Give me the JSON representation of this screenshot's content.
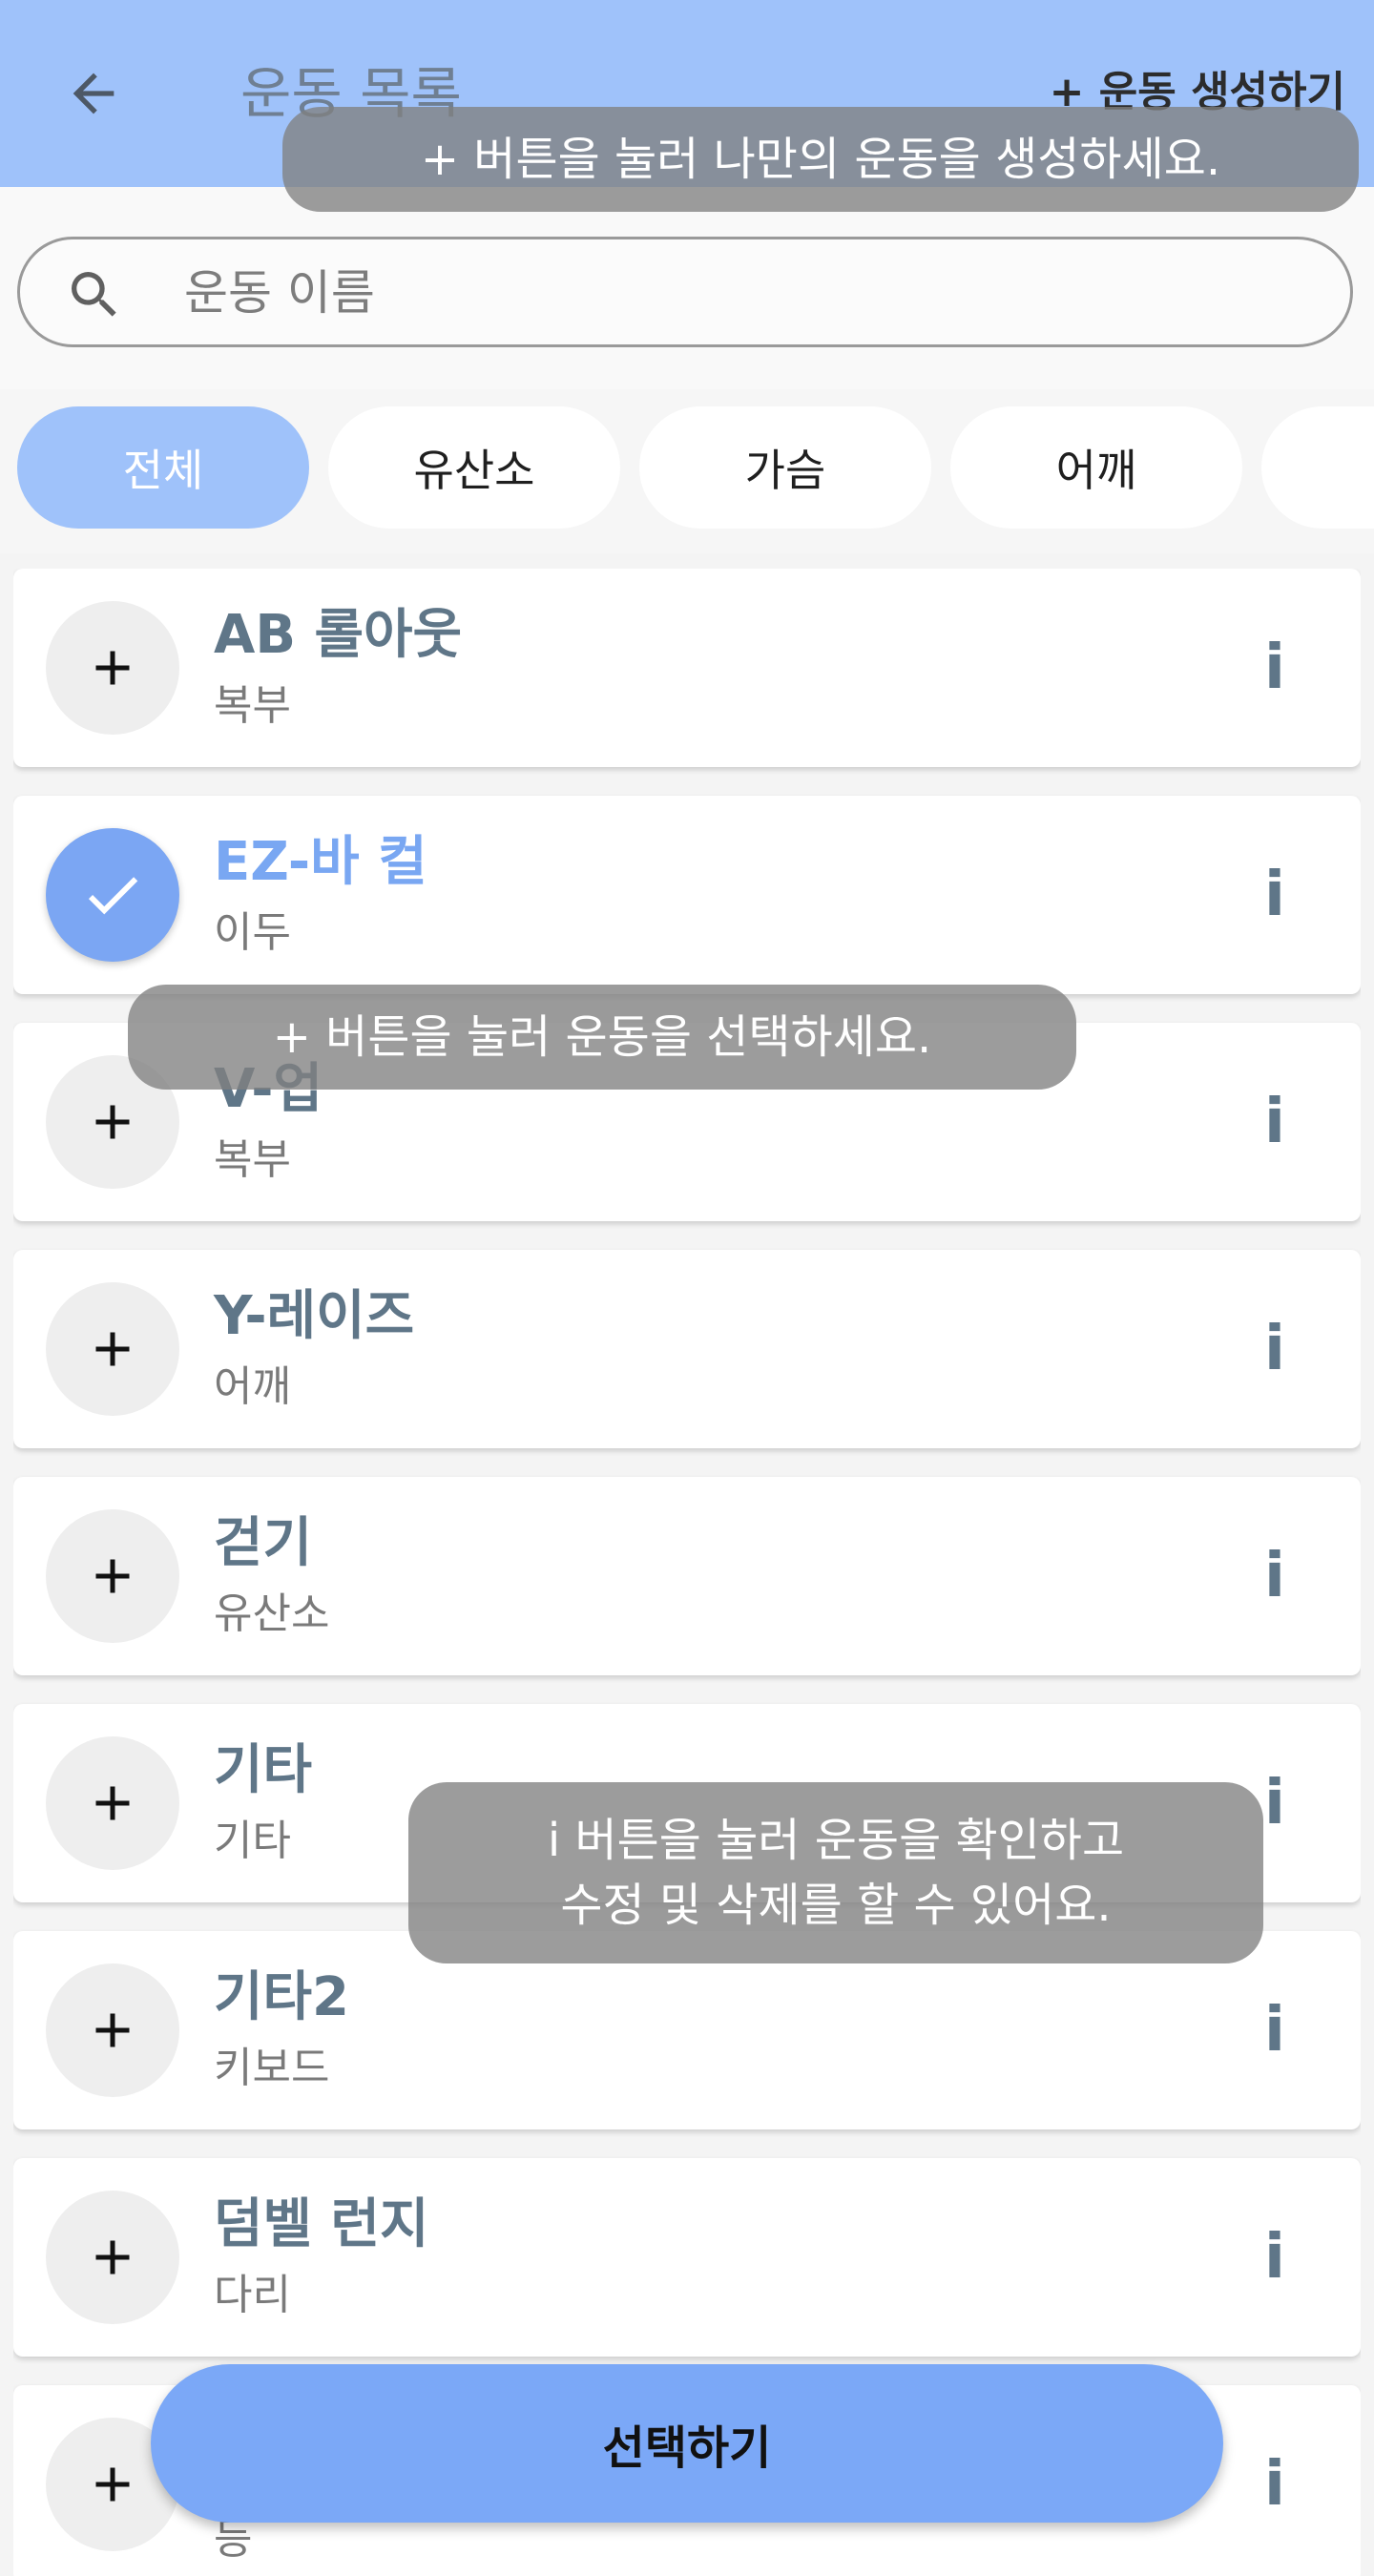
{
  "header": {
    "title": "운동 목록",
    "create_label": "+ 운동 생성하기",
    "back_icon": "arrow-left-icon",
    "background": "#9fc2fa"
  },
  "search": {
    "placeholder": "운동 이름",
    "value": "",
    "icon": "search-icon"
  },
  "filters": [
    {
      "label": "전체",
      "active": true
    },
    {
      "label": "유산소",
      "active": false
    },
    {
      "label": "가슴",
      "active": false
    },
    {
      "label": "어깨",
      "active": false
    },
    {
      "label": "",
      "active": false
    }
  ],
  "exercises": [
    {
      "name": "AB 롤아웃",
      "category": "복부",
      "selected": false
    },
    {
      "name": "EZ-바 컬",
      "category": "이두",
      "selected": true
    },
    {
      "name": "V-업",
      "category": "복부",
      "selected": false
    },
    {
      "name": "Y-레이즈",
      "category": "어깨",
      "selected": false
    },
    {
      "name": "걷기",
      "category": "유산소",
      "selected": false
    },
    {
      "name": "기타",
      "category": "기타",
      "selected": false
    },
    {
      "name": "기타2",
      "category": "키보드",
      "selected": false
    },
    {
      "name": "덤벨 런지",
      "category": "다리",
      "selected": false
    },
    {
      "name": "",
      "category": "등",
      "selected": false
    }
  ],
  "info_label": "i",
  "tooltips": {
    "create": "+ 버튼을 눌러 나만의 운동을 생성하세요.",
    "select": "+ 버튼을 눌러 운동을 선택하세요.",
    "info_line1": "i 버튼을 눌러 운동을 확인하고",
    "info_line2": "수정 및 삭제를 할 수 있어요."
  },
  "select_button": "선택하기",
  "colors": {
    "accent": "#79a7f2",
    "header": "#9fc2fa",
    "button": "#7ba8f7"
  }
}
